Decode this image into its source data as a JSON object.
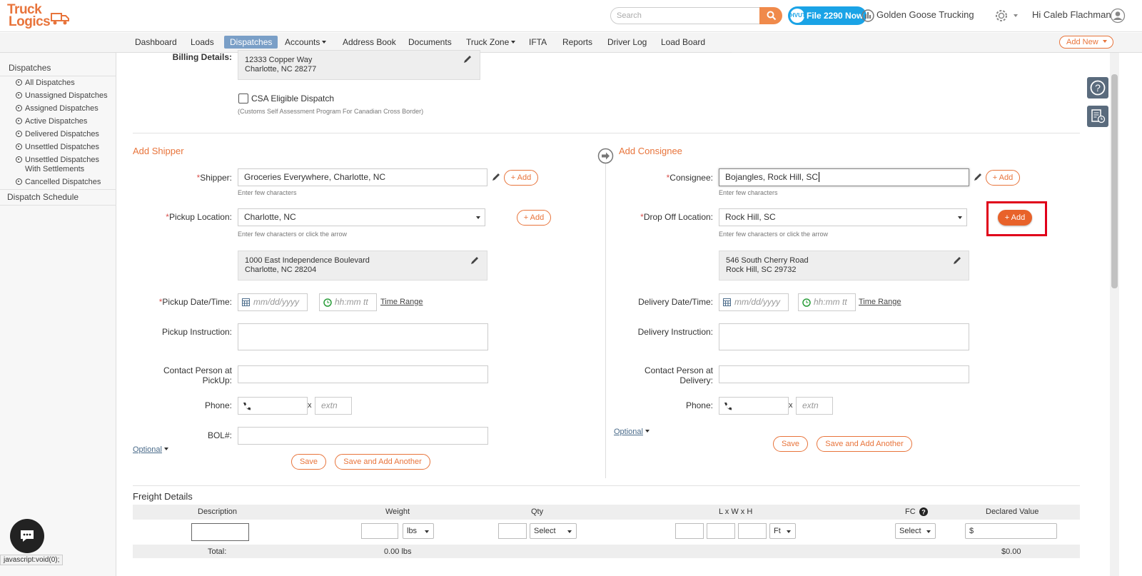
{
  "brand": {
    "logo_line1": "Truck",
    "logo_line2": "Logics"
  },
  "header": {
    "search_placeholder": "Search",
    "file_button": "File 2290 Now",
    "file_badge": "HVUT",
    "company": "Golden Goose Trucking",
    "user_greeting": "Hi Caleb Flachman"
  },
  "nav": {
    "items": [
      "Dashboard",
      "Loads",
      "Dispatches",
      "Accounts",
      "Address Book",
      "Documents",
      "Truck Zone",
      "IFTA",
      "Reports",
      "Driver Log",
      "Load Board"
    ],
    "active": "Dispatches",
    "add_new": "Add New"
  },
  "sidebar": {
    "heading": "Dispatches",
    "items": [
      "All Dispatches",
      "Unassigned Dispatches",
      "Assigned Dispatches",
      "Active Dispatches",
      "Delivered Dispatches",
      "Unsettled Dispatches",
      "Unsettled Dispatches With Settlements",
      "Cancelled Dispatches"
    ],
    "schedule": "Dispatch Schedule"
  },
  "billing": {
    "label": "Billing Details:",
    "line1": "12333 Copper Way",
    "line2": "Charlotte, NC 28277",
    "csa_label": "CSA Eligible Dispatch",
    "csa_hint": "(Customs Self Assessment Program For Canadian Cross Border)"
  },
  "shipper": {
    "title": "Add Shipper",
    "shipper_label": "Shipper:",
    "shipper_value": "Groceries Everywhere, Charlotte, NC",
    "shipper_hint": "Enter few characters",
    "pickup_label": "Pickup Location:",
    "pickup_value": "Charlotte, NC",
    "pickup_hint": "Enter few characters or click the arrow",
    "addr1": "1000 East Independence Boulevard",
    "addr2": "Charlotte, NC 28204",
    "date_label": "Pickup Date/Time:",
    "date_ph": "mm/dd/yyyy",
    "time_ph": "hh:mm tt",
    "time_range": "Time Range",
    "instr_label": "Pickup Instruction:",
    "contact_label1": "Contact Person at",
    "contact_label2": "PickUp:",
    "phone_label": "Phone:",
    "extn_ph": "extn",
    "bol_label": "BOL#:",
    "optional": "Optional",
    "save": "Save",
    "save_another": "Save and Add Another"
  },
  "consignee": {
    "title": "Add Consignee",
    "consignee_label": "Consignee:",
    "consignee_value": "Bojangles, Rock Hill, SC",
    "consignee_hint": "Enter few characters",
    "drop_label": "Drop Off Location:",
    "drop_value": "Rock Hill, SC",
    "drop_hint": "Enter few characters or click the arrow",
    "addr1": "546 South Cherry Road",
    "addr2": "Rock Hill, SC 29732",
    "date_label": "Delivery Date/Time:",
    "date_ph": "mm/dd/yyyy",
    "time_ph": "hh:mm tt",
    "time_range": "Time Range",
    "instr_label": "Delivery Instruction:",
    "contact_label1": "Contact Person at",
    "contact_label2": "Delivery:",
    "phone_label": "Phone:",
    "extn_ph": "extn",
    "optional": "Optional",
    "save": "Save",
    "save_another": "Save and Add Another"
  },
  "add_label": "Add",
  "freight": {
    "title": "Freight Details",
    "headers": [
      "Description",
      "Weight",
      "Qty",
      "L x W x H",
      "FC",
      "Declared Value"
    ],
    "weight_unit": "lbs",
    "qty_select": "Select",
    "dim_unit": "Ft",
    "fc_select": "Select",
    "currency": "$",
    "total_label": "Total:",
    "total_weight": "0.00 lbs",
    "total_value": "$0.00"
  },
  "status_bar": "javascript:void(0);",
  "colors": {
    "accent": "#e8743b",
    "nav_active": "#7a9fc7",
    "file_button": "#1aa3e6",
    "highlight": "#e0001a"
  }
}
